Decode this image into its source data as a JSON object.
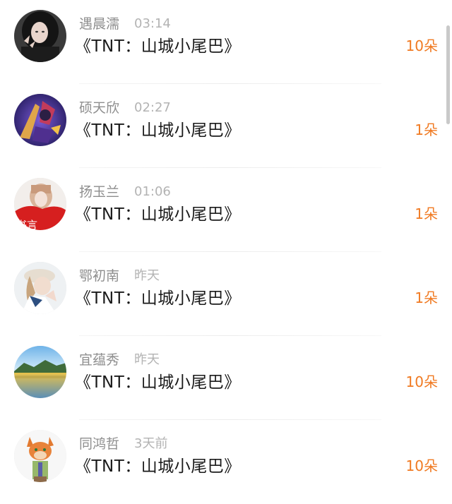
{
  "items": [
    {
      "name": "遇晨濡",
      "time": "03:14",
      "title": "《TNT：山城小尾巴》",
      "count": "10朵",
      "avatar_icon": "girl-peace-sign-avatar"
    },
    {
      "name": "硕天欣",
      "time": "02:27",
      "title": "《TNT：山城小尾巴》",
      "count": "1朵",
      "avatar_icon": "game-hero-avatar"
    },
    {
      "name": "扬玉兰",
      "time": "01:06",
      "title": "《TNT：山城小尾巴》",
      "count": "1朵",
      "avatar_icon": "red-dress-girl-avatar",
      "avatar_text": "书言"
    },
    {
      "name": "鄂初南",
      "time": "昨天",
      "title": "《TNT：山城小尾巴》",
      "count": "1朵",
      "avatar_icon": "sailor-girl-avatar"
    },
    {
      "name": "宜蕴秀",
      "time": "昨天",
      "title": "《TNT：山城小尾巴》",
      "count": "10朵",
      "avatar_icon": "lake-landscape-avatar"
    },
    {
      "name": "同鸿哲",
      "time": "3天前",
      "title": "《TNT：山城小尾巴》",
      "count": "10朵",
      "avatar_icon": "cartoon-fox-avatar"
    }
  ],
  "colors": {
    "count": "#f07a22",
    "name": "#8e8e8e",
    "time": "#b3b3b3",
    "title": "#1a1a1a"
  }
}
